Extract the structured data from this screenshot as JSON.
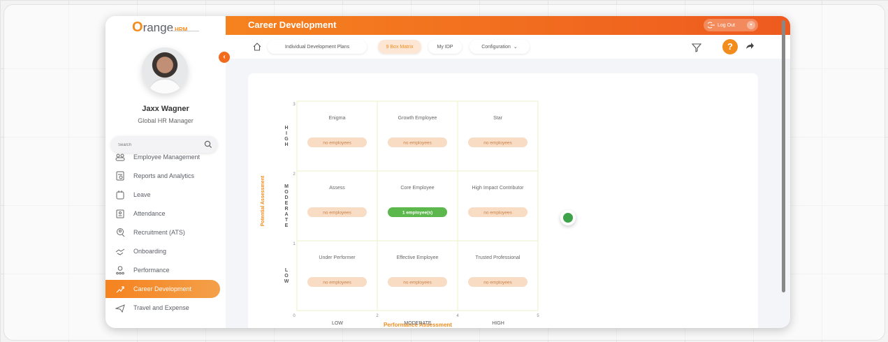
{
  "app": {
    "brand_main": "range",
    "brand_accent": "O",
    "brand_suffix": "HRM",
    "accent_color": "#f5821f"
  },
  "user": {
    "name": "Jaxx Wagner",
    "role": "Global HR Manager"
  },
  "sidebar": {
    "search_placeholder": "Search",
    "items": [
      {
        "label": "Employee Management",
        "icon": "people-icon"
      },
      {
        "label": "Reports and Analytics",
        "icon": "report-icon"
      },
      {
        "label": "Leave",
        "icon": "leave-icon"
      },
      {
        "label": "Attendance",
        "icon": "attendance-icon"
      },
      {
        "label": "Recruitment (ATS)",
        "icon": "recruitment-icon"
      },
      {
        "label": "Onboarding",
        "icon": "onboarding-icon"
      },
      {
        "label": "Performance",
        "icon": "performance-icon"
      },
      {
        "label": "Career Development",
        "icon": "career-icon",
        "active": true
      },
      {
        "label": "Travel and Expense",
        "icon": "travel-icon"
      }
    ]
  },
  "header": {
    "title": "Career Development",
    "logout_label": "Log Out"
  },
  "subnav": {
    "tabs": [
      {
        "label": "Individual Development Plans"
      },
      {
        "label": "9 Box Matrix",
        "active": true
      },
      {
        "label": "My IDP"
      },
      {
        "label": "Configuration"
      }
    ]
  },
  "matrix": {
    "ylabel": "Potential Assessment",
    "xlabel": "Performance Assessment",
    "y_bands": [
      "HIGH",
      "MODERATE",
      "LOW"
    ],
    "x_bands": [
      "LOW",
      "MODERATE",
      "HIGH"
    ],
    "y_ticks": [
      "3",
      "2",
      "1",
      "0"
    ],
    "x_ticks": [
      "0",
      "2",
      "4",
      "5"
    ],
    "cells": [
      {
        "title": "Enigma",
        "badge": "no employees",
        "highlight": false
      },
      {
        "title": "Growth Employee",
        "badge": "no employees",
        "highlight": false
      },
      {
        "title": "Star",
        "badge": "no employees",
        "highlight": false
      },
      {
        "title": "Assess",
        "badge": "no employees",
        "highlight": false
      },
      {
        "title": "Core Employee",
        "badge": "1 employee(s)",
        "highlight": true
      },
      {
        "title": "High Impact Contributor",
        "badge": "no employees",
        "highlight": false
      },
      {
        "title": "Under Performer",
        "badge": "no employees",
        "highlight": false
      },
      {
        "title": "Effective Employee",
        "badge": "no employees",
        "highlight": false
      },
      {
        "title": "Trusted Professional",
        "badge": "no employees",
        "highlight": false
      }
    ]
  }
}
